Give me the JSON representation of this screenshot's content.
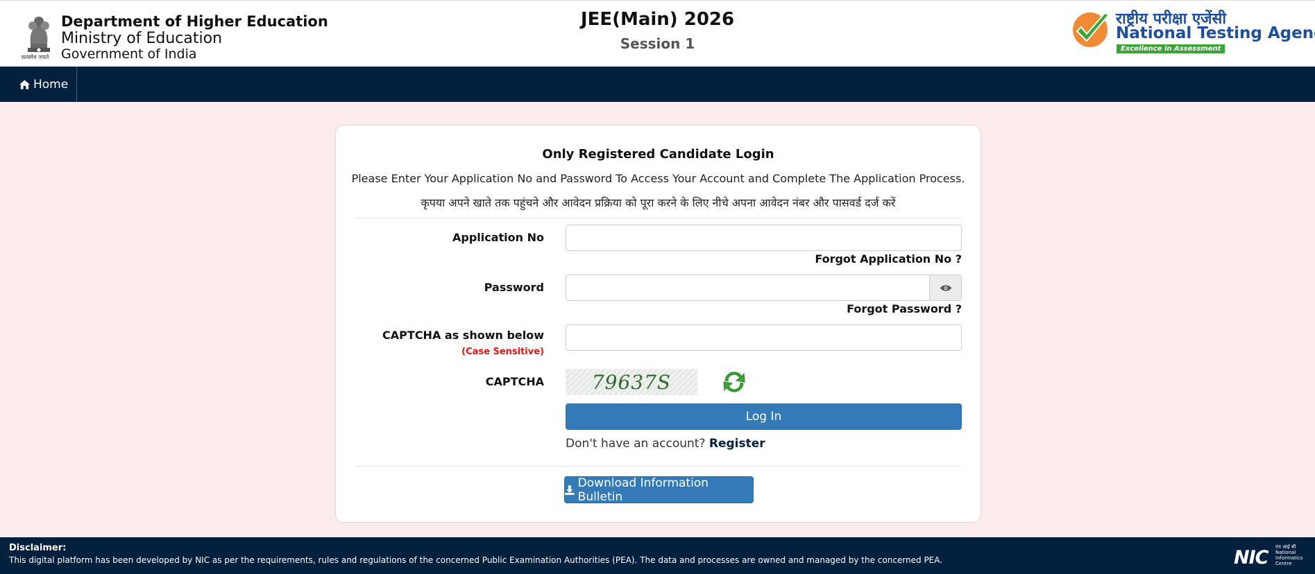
{
  "header": {
    "emblem_caption": "सत्यमेव जयते",
    "dept_line1": "Department of Higher Education",
    "dept_line2": "Ministry of Education",
    "dept_line3": "Government of India",
    "exam_title": "JEE(Main) 2026",
    "exam_session": "Session 1",
    "nta_hindi": "राष्ट्रीय परीक्षा एजेंसी",
    "nta_english": "National Testing Agency",
    "nta_tagline": "Excellence in Assessment"
  },
  "nav": {
    "home_label": "Home"
  },
  "login": {
    "title": "Only Registered Candidate Login",
    "subtitle": "Please Enter Your Application No and Password To Access Your Account and Complete The Application Process.",
    "subtitle_hindi": "कृपया अपने खाते तक पहुंचने और आवेदन प्रक्रिया को पूरा करने के लिए नीचे अपना आवेदन नंबर और पासवर्ड दर्ज करें",
    "app_no_label": "Application No",
    "app_no_value": "",
    "forgot_app_no": "Forgot Application No ?",
    "password_label": "Password",
    "password_value": "",
    "forgot_password": "Forgot Password ?",
    "captcha_input_label": "CAPTCHA as shown below",
    "captcha_case_note": "(Case Sensitive)",
    "captcha_value": "",
    "captcha_label": "CAPTCHA",
    "captcha_text": "79637S",
    "login_button": "Log In",
    "no_account_text": "Don't have an account?",
    "register_link": "Register",
    "download_button": "Download Information Bulletin"
  },
  "footer": {
    "disclaimer_title": "Disclaimer:",
    "disclaimer_text": "This digital platform has been developed by NIC as per the requirements, rules and regulations of the concerned Public Examination Authorities (PEA). The data and processes are owned and managed by the concerned PEA.",
    "nic_mark": "NIC",
    "nic_hindi": "एन आई सी",
    "nic_line1": "National",
    "nic_line2": "Informatics",
    "nic_line3": "Centre"
  },
  "colors": {
    "nav_bg": "#03203f",
    "page_bg": "#fdecec",
    "primary_button": "#337ab7",
    "nta_blue": "#1f4e9c",
    "nta_green": "#3aa535",
    "warning_red": "#e01515"
  },
  "icons": [
    "emblem-icon",
    "home-icon",
    "eye-icon",
    "refresh-icon",
    "download-icon",
    "nta-logo-icon"
  ]
}
